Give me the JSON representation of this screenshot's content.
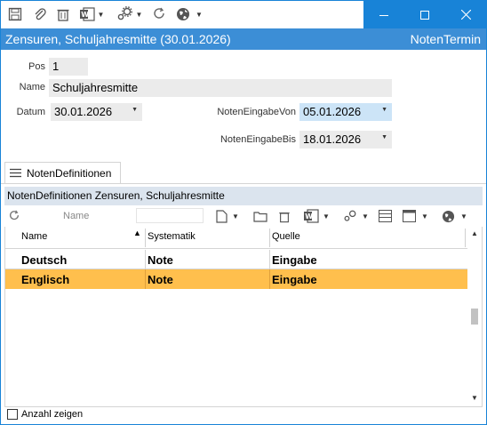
{
  "window": {
    "controls": [
      "minimize-icon",
      "maximize-icon",
      "close-icon"
    ]
  },
  "toolbar": {
    "icons": [
      "save-icon",
      "attach-icon",
      "delete-icon",
      "word-icon",
      "settings-icon",
      "refresh-icon",
      "globe-icon"
    ]
  },
  "form": {
    "title": "Zensuren, Schuljahresmitte (30.01.2026)",
    "right_title": "NotenTermin"
  },
  "fields": {
    "pos_label": "Pos",
    "pos_value": "1",
    "name_label": "Name",
    "name_value": "Schuljahresmitte",
    "datum_label": "Datum",
    "datum_value": "30.01.2026",
    "von_label": "NotenEingabeVon",
    "von_value": "05.01.2026",
    "bis_label": "NotenEingabeBis",
    "bis_value": "18.01.2026"
  },
  "tab": {
    "label": "NotenDefinitionen"
  },
  "subgrid": {
    "title": "NotenDefinitionen Zensuren, Schuljahresmitte",
    "filter_label": "Name",
    "columns": [
      "Name",
      "Systematik",
      "Quelle"
    ],
    "rows": [
      {
        "name": "Deutsch",
        "systematik": "Note",
        "quelle": "Eingabe"
      },
      {
        "name": "Englisch",
        "systematik": "Note",
        "quelle": "Eingabe"
      }
    ],
    "selected_row_color": "#ffbf4d"
  },
  "footer": {
    "checkbox_label": "Anzahl zeigen"
  },
  "colors": {
    "accent": "#1883d7",
    "header": "#3c8ed6"
  }
}
